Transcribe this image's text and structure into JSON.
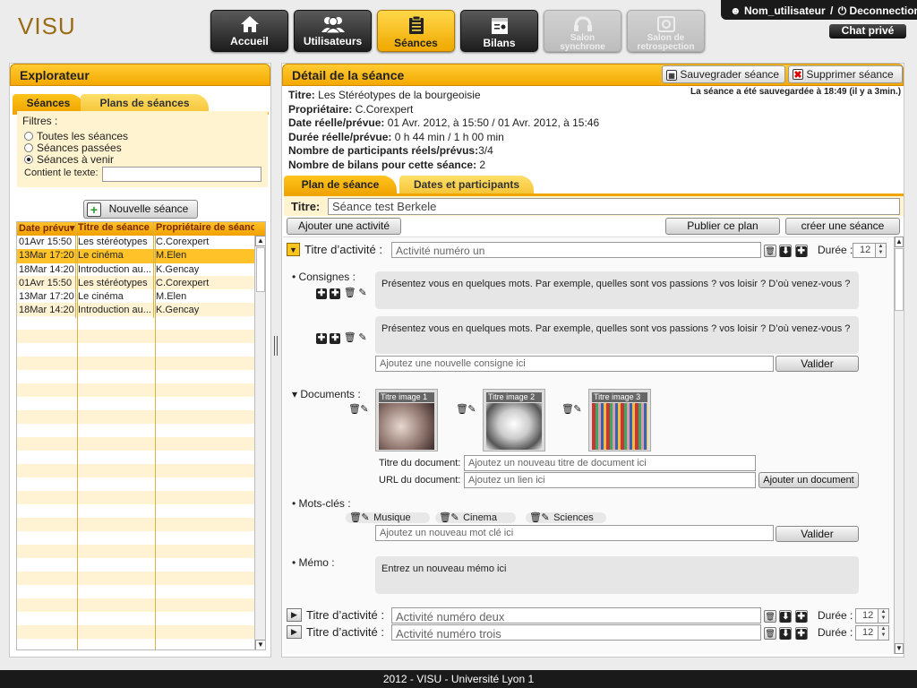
{
  "app": {
    "brand": "VISU"
  },
  "nav": [
    {
      "label": "Accueil",
      "icon": "home-icon"
    },
    {
      "label": "Utilisateurs",
      "icon": "users-icon"
    },
    {
      "label": "Séances",
      "icon": "clipboard-icon"
    },
    {
      "label": "Bilans",
      "icon": "report-icon"
    },
    {
      "label": "Salon synchrone",
      "icon": "headset-icon"
    },
    {
      "label": "Salon de retrospection",
      "icon": "refresh-icon"
    }
  ],
  "user": {
    "name": "Nom_utilisateur",
    "separator": "/",
    "logout": "Deconnection",
    "chat": "Chat privé"
  },
  "explorer": {
    "title": "Explorateur",
    "tabs": [
      "Séances",
      "Plans de séances"
    ],
    "filters_label": "Filtres :",
    "radios": [
      "Toutes les séances",
      "Séances passées",
      "Séances à venir"
    ],
    "selected_radio": "Séances à venir",
    "text_filter_label": "Contient le texte:",
    "text_filter_value": "",
    "new_button": "Nouvelle séance",
    "columns": [
      "Date prévu▾",
      "Titre de séance",
      "Propriétaire de séance"
    ],
    "rows": [
      [
        "01Avr 15:50",
        "Les stéréotypes",
        "C.Corexpert"
      ],
      [
        "13Mar 17:20",
        "Le cinéma",
        "M.Elen"
      ],
      [
        "18Mar 14:20",
        "Introduction au...",
        "K.Gencay"
      ],
      [
        "01Avr 15:50",
        "Les stéréotypes",
        "C.Corexpert"
      ],
      [
        "13Mar 17:20",
        "Le cinéma",
        "M.Elen"
      ],
      [
        "18Mar 14:20",
        "Introduction au...",
        "K.Gencay"
      ]
    ],
    "selected_row": 1
  },
  "detail": {
    "title": "Détail de la séance",
    "save_button": "Sauvegrader séance",
    "delete_button": "Supprimer séance",
    "saved_notice": "La séance a été sauvegardée à 18:49 (il y a 3min.)",
    "info": [
      {
        "label": "Titre:",
        "value": "Les Stéréotypes de la bourgeoisie"
      },
      {
        "label": "Propriétaire:",
        "value": "C.Corexpert"
      },
      {
        "label": "Date réelle/prévue:",
        "value": "01 Avr. 2012, à 15:50 / 01 Avr. 2012, à 15:46"
      },
      {
        "label": "Durée réelle/prévue:",
        "value": "0 h 44 min / 1 h 00 min"
      },
      {
        "label": "Nombre de participants réels/prévus:",
        "value": "3/4"
      },
      {
        "label": "Nombre de bilans pour cette séance:",
        "value": "2"
      }
    ],
    "tabs": [
      "Plan de séance",
      "Dates et participants"
    ],
    "plan": {
      "title_label": "Titre:",
      "title_value": "Séance test Berkele",
      "add_activity": "Ajouter une activité",
      "publish": "Publier ce plan",
      "create": "créer une séance",
      "activity_label": "Titre d’activité :",
      "duration_label": "Durée :",
      "activities": [
        {
          "title": "Activité numéro un",
          "duration": "12"
        },
        {
          "title": "Activité numéro deux",
          "duration": "12"
        },
        {
          "title": "Activité numéro trois",
          "duration": "12"
        }
      ],
      "consignes_label": "Consignes :",
      "consignes": [
        "Présentez vous en quelques mots. Par exemple, quelles sont vos passions ? vos loisir ? D’où venez-vous ?",
        "Présentez vous en quelques mots. Par exemple, quelles sont vos passions ? vos loisir ? D’où venez-vous ?"
      ],
      "consigne_placeholder": "Ajoutez une nouvelle consigne ici",
      "validate": "Valider",
      "documents_label": "Documents :",
      "documents": [
        "Titre image 1",
        "Titre image 2",
        "Titre image 3"
      ],
      "doc_title_label": "Titre du document:",
      "doc_title_placeholder": "Ajoutez un nouveau titre de document ici",
      "doc_url_label": "URL du document:",
      "doc_url_placeholder": "Ajoutez un lien ici",
      "add_document": "Ajouter un document",
      "keywords_label": "Mots-clés :",
      "keywords": [
        "Musique",
        "Cinema",
        "Sciences"
      ],
      "keyword_placeholder": "Ajoutez un nouveau mot clé ici",
      "memo_label": "Mémo :",
      "memo_placeholder": "Entrez un nouveau mémo ici"
    }
  },
  "footer": "2012 - VISU - Université Lyon 1"
}
